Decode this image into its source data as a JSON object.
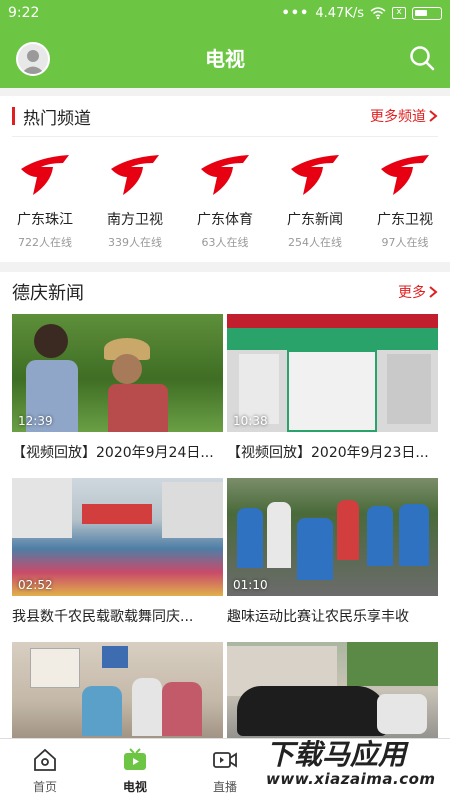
{
  "status": {
    "time": "9:22",
    "dots": "•••",
    "speed": "4.47K/s",
    "x_badge": "x"
  },
  "header": {
    "title": "电视"
  },
  "hot_channels": {
    "title": "热门频道",
    "more": "更多频道",
    "items": [
      {
        "name": "广东珠江",
        "count": "722人在线"
      },
      {
        "name": "南方卫视",
        "count": "339人在线"
      },
      {
        "name": "广东体育",
        "count": "63人在线"
      },
      {
        "name": "广东新闻",
        "count": "254人在线"
      },
      {
        "name": "广东卫视",
        "count": "97人在线"
      }
    ]
  },
  "news": {
    "title": "德庆新闻",
    "more": "更多",
    "items": [
      {
        "duration": "12:39",
        "title": "【视频回放】2020年9月24日..."
      },
      {
        "duration": "10:38",
        "title": "【视频回放】2020年9月23日..."
      },
      {
        "duration": "02:52",
        "title": "我县数千农民载歌载舞同庆..."
      },
      {
        "duration": "01:10",
        "title": "趣味运动比赛让农民乐享丰收"
      },
      {
        "duration": "",
        "title": ""
      },
      {
        "duration": "",
        "title": ""
      }
    ]
  },
  "nav": {
    "home": "首页",
    "tv": "电视",
    "live": "直播"
  },
  "watermark": {
    "title": "下载马应用",
    "url": "www.xiazaima.com"
  },
  "colors": {
    "accent": "#6cc644",
    "red": "#e02020"
  }
}
